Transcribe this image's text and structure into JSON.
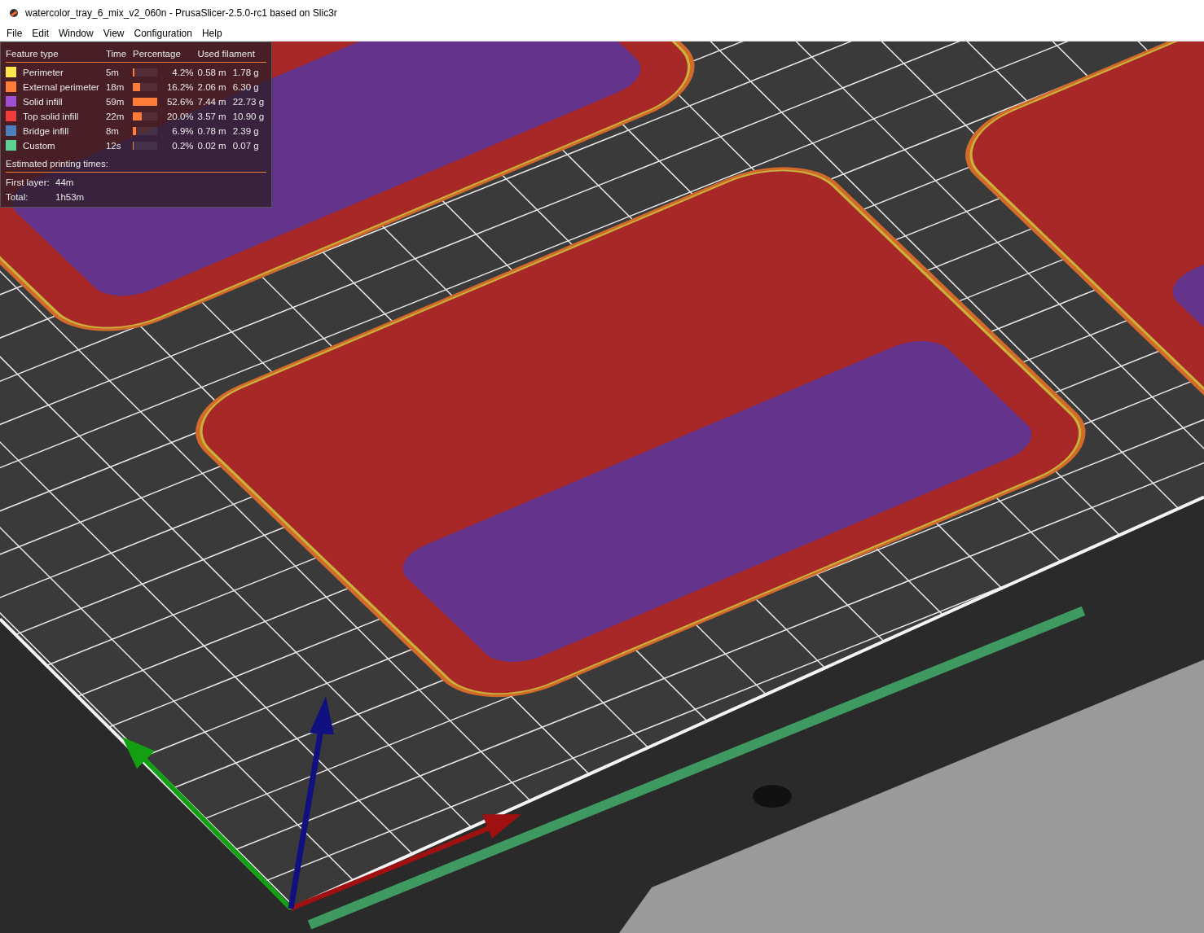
{
  "window": {
    "title": "watercolor_tray_6_mix_v2_060n - PrusaSlicer-2.5.0-rc1 based on Slic3r"
  },
  "menu": [
    "File",
    "Edit",
    "Window",
    "View",
    "Configuration",
    "Help"
  ],
  "legend": {
    "columns": [
      "Feature type",
      "Time",
      "Percentage",
      "Used filament"
    ],
    "rows": [
      {
        "name": "Perimeter",
        "color": "#ffe64d",
        "time": "5m",
        "level": 0.08,
        "percentage": "4.2%",
        "length": "0.58 m",
        "weight": "1.78 g"
      },
      {
        "name": "External perimeter",
        "color": "#ff7d38",
        "time": "18m",
        "level": 0.31,
        "percentage": "16.2%",
        "length": "2.06 m",
        "weight": "6.30 g"
      },
      {
        "name": "Solid infill",
        "color": "#a04fd1",
        "time": "59m",
        "level": 1,
        "percentage": "52.6%",
        "length": "7.44 m",
        "weight": "22.73 g"
      },
      {
        "name": "Top solid infill",
        "color": "#f03c3c",
        "time": "22m",
        "level": 0.38,
        "percentage": "20.0%",
        "length": "3.57 m",
        "weight": "10.90 g"
      },
      {
        "name": "Bridge infill",
        "color": "#4d80ba",
        "time": "8m",
        "level": 0.13,
        "percentage": "6.9%",
        "length": "0.78 m",
        "weight": "2.39 g"
      },
      {
        "name": "Custom",
        "color": "#5ed194",
        "time": "12s",
        "level": 0.01,
        "percentage": "0.2%",
        "length": "0.02 m",
        "weight": "0.07 g"
      }
    ],
    "estimated_title": "Estimated printing times:",
    "times": [
      {
        "label": "First layer:",
        "value": "44m"
      },
      {
        "label": "Total:",
        "value": "1h53m"
      }
    ]
  }
}
